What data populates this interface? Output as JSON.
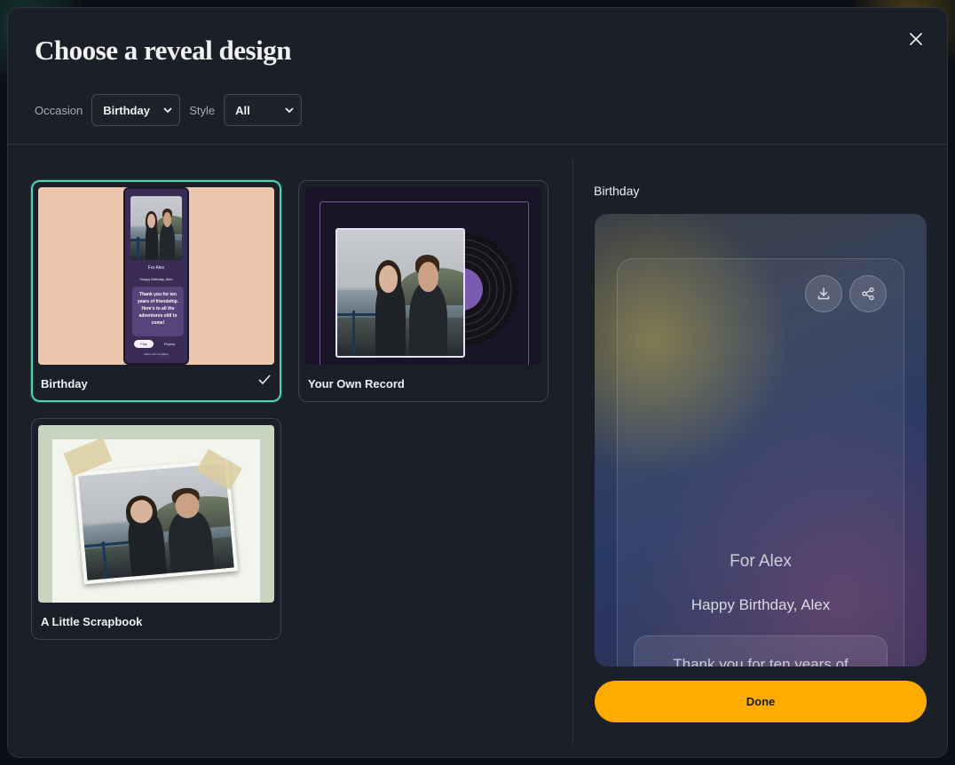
{
  "modal": {
    "title": "Choose a reveal design",
    "close_icon": "close-icon"
  },
  "filters": {
    "occasion_label": "Occasion",
    "occasion_value": "Birthday",
    "style_label": "Style",
    "style_value": "All"
  },
  "designs": [
    {
      "label": "Birthday",
      "selected": true,
      "thumb": {
        "for_text": "For Alex",
        "greeting": "Happy Birthday, Alex",
        "message": "Thank you for ten years of friendship. Here's to all the adventures still to come!",
        "btn1": "Play",
        "btn2": "Replay",
        "footer": "Made with SongBerg"
      }
    },
    {
      "label": "Your Own Record",
      "selected": false
    },
    {
      "label": "A Little Scrapbook",
      "selected": false
    }
  ],
  "preview": {
    "title": "Birthday",
    "for_text": "For Alex",
    "greeting": "Happy Birthday, Alex",
    "message": "Thank you for ten years of",
    "download_icon": "download-icon",
    "share_icon": "share-icon"
  },
  "done_label": "Done",
  "colors": {
    "accent_selected": "#4fd1b8",
    "done_button": "#ffab00",
    "modal_bg": "#1b1f27"
  }
}
